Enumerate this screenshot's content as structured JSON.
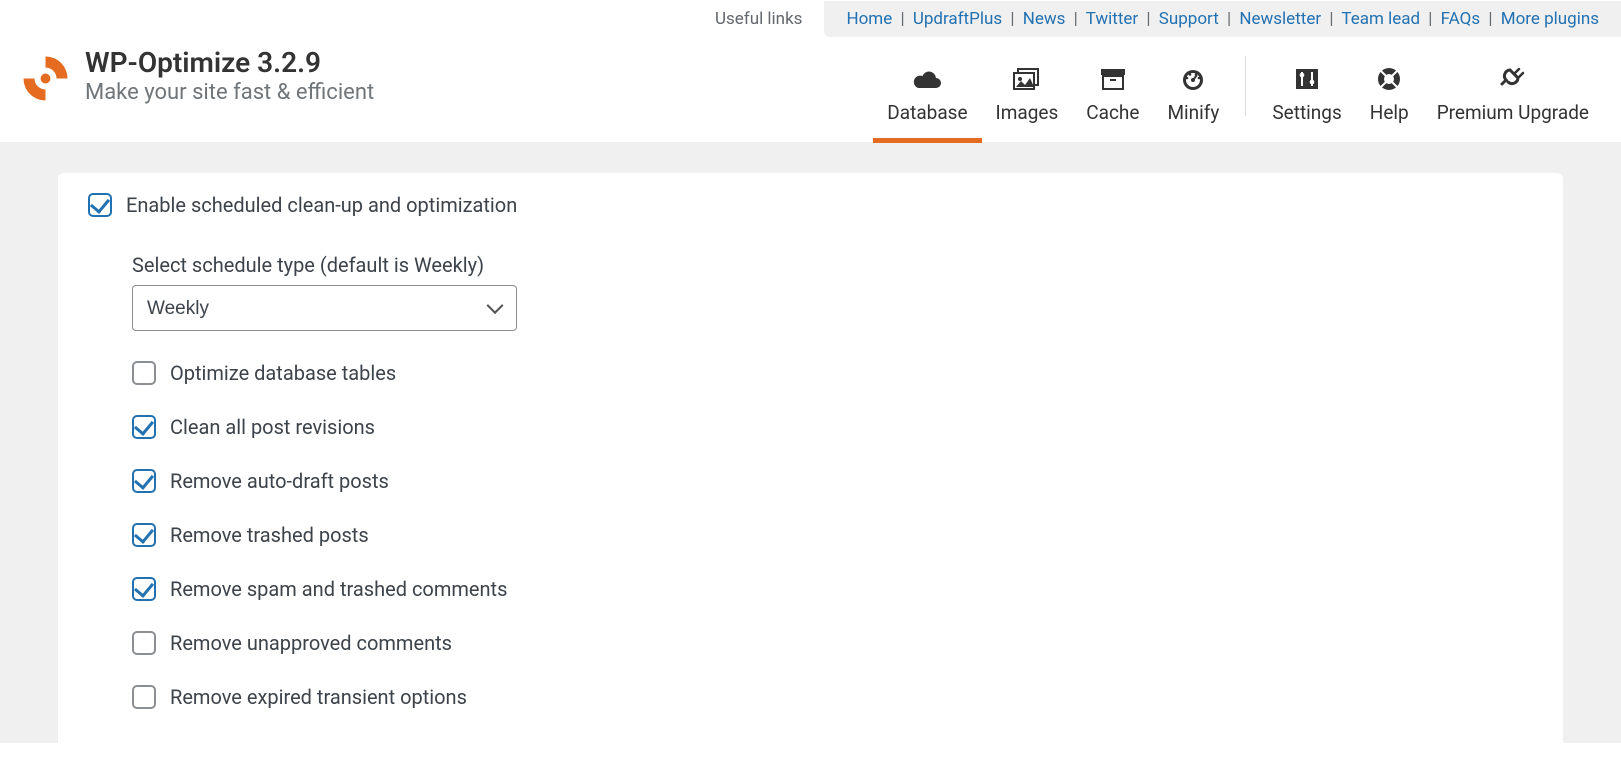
{
  "useful_links_label": "Useful links",
  "top_links": {
    "home": "Home",
    "updraftplus": "UpdraftPlus",
    "news": "News",
    "twitter": "Twitter",
    "support": "Support",
    "newsletter": "Newsletter",
    "team_lead": "Team lead",
    "faqs": "FAQs",
    "more_plugins": "More plugins"
  },
  "brand": {
    "title": "WP-Optimize 3.2.9",
    "tagline": "Make your site fast & efficient"
  },
  "tabs": {
    "database": "Database",
    "images": "Images",
    "cache": "Cache",
    "minify": "Minify",
    "settings": "Settings",
    "help": "Help",
    "premium": "Premium Upgrade"
  },
  "options": {
    "enable_scheduled": "Enable scheduled clean-up and optimization",
    "schedule_label": "Select schedule type (default is Weekly)",
    "schedule_value": "Weekly",
    "items": [
      {
        "label": "Optimize database tables",
        "checked": false
      },
      {
        "label": "Clean all post revisions",
        "checked": true
      },
      {
        "label": "Remove auto-draft posts",
        "checked": true
      },
      {
        "label": "Remove trashed posts",
        "checked": true
      },
      {
        "label": "Remove spam and trashed comments",
        "checked": true
      },
      {
        "label": "Remove unapproved comments",
        "checked": false
      },
      {
        "label": "Remove expired transient options",
        "checked": false
      }
    ]
  }
}
